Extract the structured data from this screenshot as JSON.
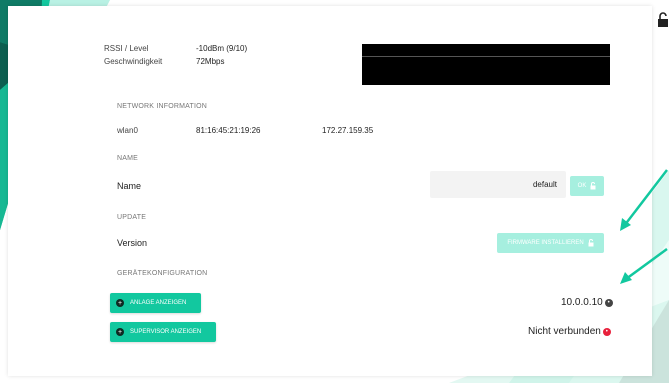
{
  "wifi": {
    "rssi_label": "RSSI / Level",
    "rssi_value": "-10dBm (9/10)",
    "speed_label": "Geschwindigkeit",
    "speed_value": "72Mbps"
  },
  "network": {
    "section_title": "NETWORK INFORMATION",
    "interface": "wlan0",
    "mac": "81:16:45:21:19:26",
    "ip": "172.27.159.35"
  },
  "name_section": {
    "section_title": "NAME",
    "label": "Name",
    "value": "default",
    "ok_button": "OK"
  },
  "update": {
    "section_title": "UPDATE",
    "label": "Version",
    "install_button": "FIRMWARE INSTALLIEREN"
  },
  "config": {
    "section_title": "GERÄTEKONFIGURATION",
    "anlage_button": "ANLAGE ANZEIGEN",
    "anlage_status": "10.0.0.10",
    "supervisor_button": "SUPERVISOR ANZEIGEN",
    "supervisor_status": "Nicht verbunden"
  },
  "colors": {
    "accent": "#12c89f",
    "accent_disabled": "#a6efdf",
    "error": "#e8213c",
    "ok_gray": "#555555"
  },
  "icons": [
    "back-arrow-icon",
    "lock-icon",
    "plus-circle-icon",
    "status-dot-icon",
    "pointer-arrow-icon"
  ]
}
